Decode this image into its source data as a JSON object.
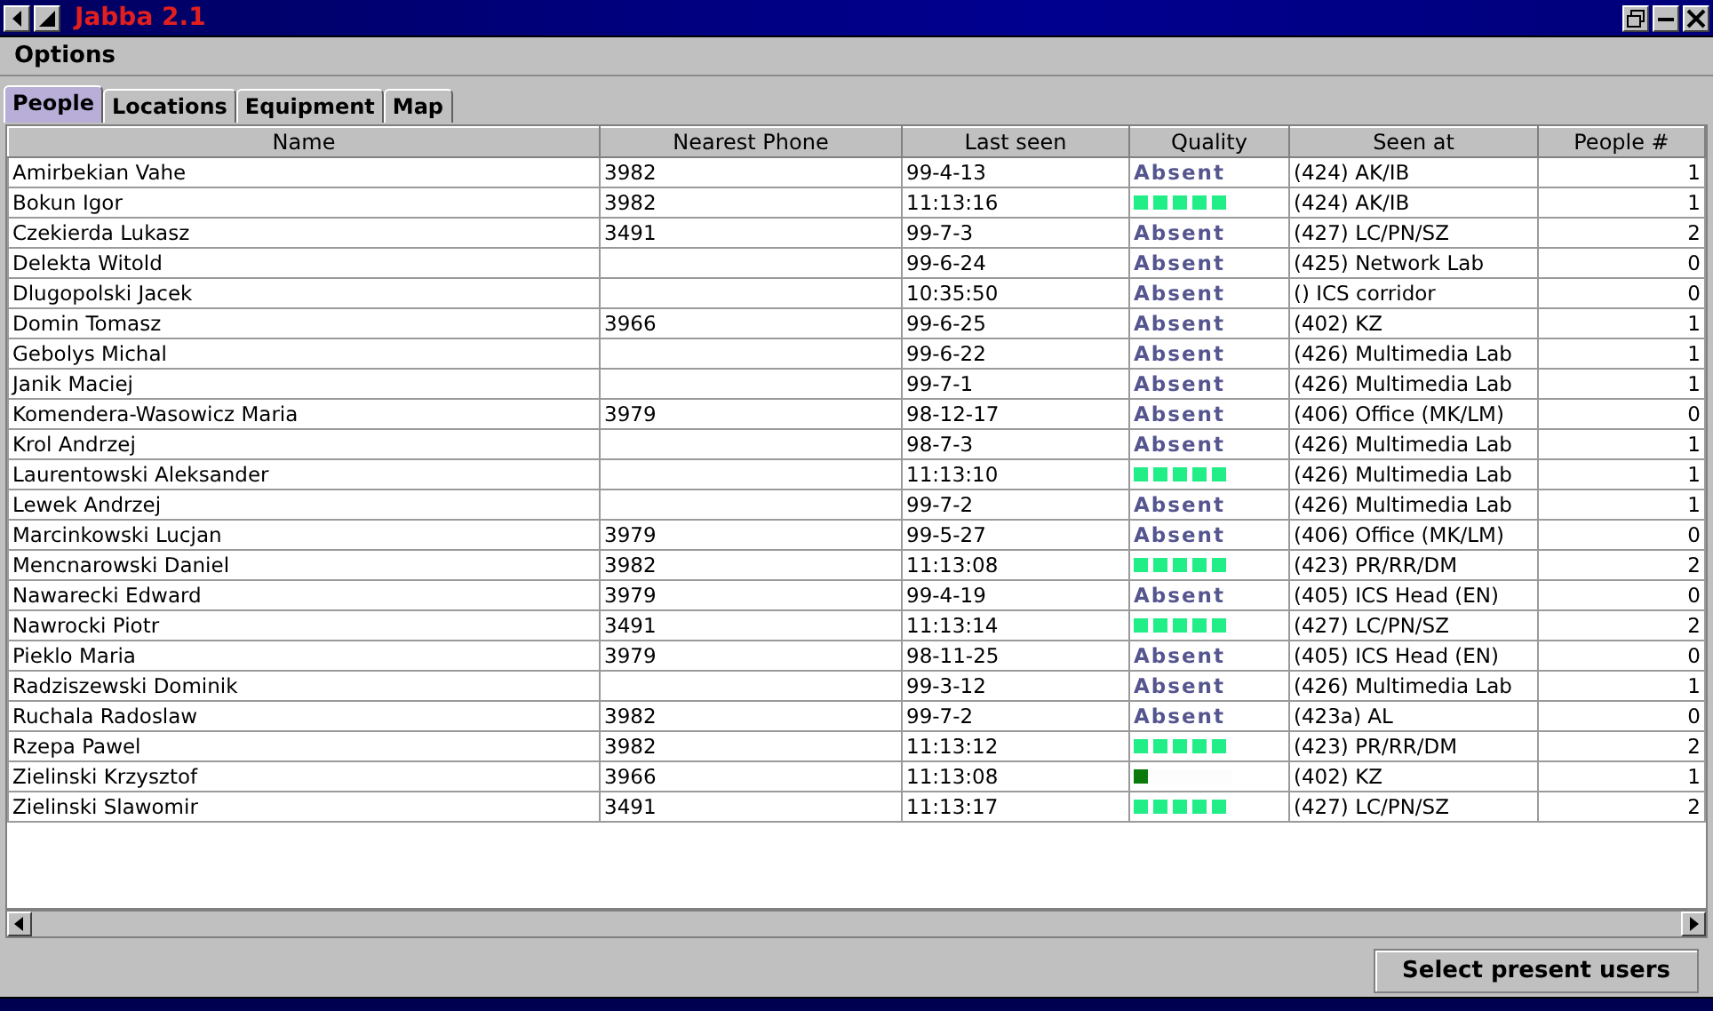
{
  "window": {
    "title": "Jabba 2.1"
  },
  "menu": [
    {
      "label": "Options"
    }
  ],
  "tabs": [
    {
      "label": "People",
      "selected": true
    },
    {
      "label": "Locations",
      "selected": false
    },
    {
      "label": "Equipment",
      "selected": false
    },
    {
      "label": "Map",
      "selected": false
    }
  ],
  "table": {
    "columns": [
      "Name",
      "Nearest Phone",
      "Last seen",
      "Quality",
      "Seen at",
      "People #"
    ],
    "rows": [
      {
        "name": "Amirbekian Vahe",
        "phone": "3982",
        "last_seen": "99-4-13",
        "quality": {
          "kind": "text",
          "text": "Absent"
        },
        "seen_at": "(424) AK/IB",
        "people": "1"
      },
      {
        "name": "Bokun Igor",
        "phone": "3982",
        "last_seen": "11:13:16",
        "quality": {
          "kind": "bars",
          "level": 1,
          "color": "#22ee88"
        },
        "seen_at": "(424) AK/IB",
        "people": "1"
      },
      {
        "name": "Czekierda Lukasz",
        "phone": "3491",
        "last_seen": "99-7-3",
        "quality": {
          "kind": "text",
          "text": "Absent"
        },
        "seen_at": "(427) LC/PN/SZ",
        "people": "2"
      },
      {
        "name": "Delekta Witold",
        "last_seen": "99-6-24",
        "quality": {
          "kind": "text",
          "text": "Absent"
        },
        "seen_at": "(425) Network Lab",
        "people": "0"
      },
      {
        "name": "Dlugopolski Jacek",
        "last_seen": "10:35:50",
        "quality": {
          "kind": "text",
          "text": "Absent"
        },
        "seen_at": "() ICS corridor",
        "people": "0"
      },
      {
        "name": "Domin Tomasz",
        "phone": "3966",
        "last_seen": "99-6-25",
        "quality": {
          "kind": "text",
          "text": "Absent"
        },
        "seen_at": "(402) KZ",
        "people": "1"
      },
      {
        "name": "Gebolys Michal",
        "last_seen": "99-6-22",
        "quality": {
          "kind": "text",
          "text": "Absent"
        },
        "seen_at": "(426) Multimedia Lab",
        "people": "1"
      },
      {
        "name": "Janik Maciej",
        "last_seen": "99-7-1",
        "quality": {
          "kind": "text",
          "text": "Absent"
        },
        "seen_at": "(426) Multimedia Lab",
        "people": "1"
      },
      {
        "name": "Komendera-Wasowicz Maria",
        "phone": "3979",
        "last_seen": "98-12-17",
        "quality": {
          "kind": "text",
          "text": "Absent"
        },
        "seen_at": "(406) Office (MK/LM)",
        "people": "0"
      },
      {
        "name": "Krol Andrzej",
        "last_seen": "98-7-3",
        "quality": {
          "kind": "text",
          "text": "Absent"
        },
        "seen_at": "(426) Multimedia Lab",
        "people": "1"
      },
      {
        "name": "Laurentowski Aleksander",
        "last_seen": "11:13:10",
        "quality": {
          "kind": "bars",
          "level": 1,
          "color": "#22ee88"
        },
        "seen_at": "(426) Multimedia Lab",
        "people": "1"
      },
      {
        "name": "Lewek Andrzej",
        "last_seen": "99-7-2",
        "quality": {
          "kind": "text",
          "text": "Absent"
        },
        "seen_at": "(426) Multimedia Lab",
        "people": "1"
      },
      {
        "name": "Marcinkowski Lucjan",
        "phone": "3979",
        "last_seen": "99-5-27",
        "quality": {
          "kind": "text",
          "text": "Absent"
        },
        "seen_at": "(406) Office (MK/LM)",
        "people": "0"
      },
      {
        "name": "Mencnarowski Daniel",
        "phone": "3982",
        "last_seen": "11:13:08",
        "quality": {
          "kind": "bars",
          "level": 1,
          "color": "#22ee88"
        },
        "seen_at": "(423) PR/RR/DM",
        "people": "2"
      },
      {
        "name": "Nawarecki Edward",
        "phone": "3979",
        "last_seen": "99-4-19",
        "quality": {
          "kind": "text",
          "text": "Absent"
        },
        "seen_at": "(405) ICS Head (EN)",
        "people": "0"
      },
      {
        "name": "Nawrocki Piotr",
        "phone": "3491",
        "last_seen": "11:13:14",
        "quality": {
          "kind": "bars",
          "level": 1,
          "color": "#22ee88"
        },
        "seen_at": "(427) LC/PN/SZ",
        "people": "2"
      },
      {
        "name": "Pieklo Maria",
        "phone": "3979",
        "last_seen": "98-11-25",
        "quality": {
          "kind": "text",
          "text": "Absent"
        },
        "seen_at": "(405) ICS Head (EN)",
        "people": "0"
      },
      {
        "name": "Radziszewski Dominik",
        "last_seen": "99-3-12",
        "quality": {
          "kind": "text",
          "text": "Absent"
        },
        "seen_at": "(426) Multimedia Lab",
        "people": "1"
      },
      {
        "name": "Ruchala Radoslaw",
        "phone": "3982",
        "last_seen": "99-7-2",
        "quality": {
          "kind": "text",
          "text": "Absent"
        },
        "seen_at": "(423a) AL",
        "people": "0"
      },
      {
        "name": "Rzepa Pawel",
        "phone": "3982",
        "last_seen": "11:13:12",
        "quality": {
          "kind": "bars",
          "level": 1,
          "color": "#22ee88"
        },
        "seen_at": "(423) PR/RR/DM",
        "people": "2"
      },
      {
        "name": "Zielinski Krzysztof",
        "phone": "3966",
        "last_seen": "11:13:08",
        "quality": {
          "kind": "bars",
          "level": 0.2,
          "color": "#0b7a0b"
        },
        "seen_at": "(402) KZ",
        "people": "1"
      },
      {
        "name": "Zielinski Slawomir",
        "phone": "3491",
        "last_seen": "11:13:17",
        "quality": {
          "kind": "bars",
          "level": 1,
          "color": "#22ee88"
        },
        "seen_at": "(427) LC/PN/SZ",
        "people": "2"
      }
    ]
  },
  "buttons": [
    {
      "label": "Select present users"
    }
  ]
}
